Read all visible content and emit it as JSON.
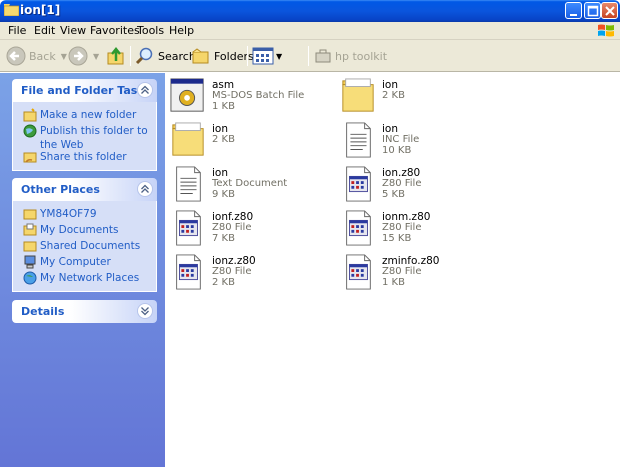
{
  "window": {
    "title": "ion[1]"
  },
  "menu": [
    "File",
    "Edit",
    "View",
    "Favorites",
    "Tools",
    "Help"
  ],
  "toolbar": {
    "back": "Back",
    "search": "Search",
    "folders": "Folders",
    "hp_toolkit": "hp toolkit"
  },
  "tasks": {
    "title": "File and Folder Tasks",
    "items": [
      "Make a new folder",
      "Publish this folder to the Web",
      "Share this folder"
    ]
  },
  "places": {
    "title": "Other Places",
    "items": [
      "YM84OF79",
      "My Documents",
      "Shared Documents",
      "My Computer",
      "My Network Places"
    ]
  },
  "details": {
    "title": "Details"
  },
  "files": [
    {
      "name": "asm",
      "type": "MS-DOS Batch File",
      "size": "1 KB",
      "icon": "batch-file-icon"
    },
    {
      "name": "ion",
      "type": "",
      "size": "2 KB",
      "icon": "folder-icon"
    },
    {
      "name": "ion",
      "type": "",
      "size": "2 KB",
      "icon": "folder-icon"
    },
    {
      "name": "ion",
      "type": "INC File",
      "size": "10 KB",
      "icon": "text-file-icon"
    },
    {
      "name": "ion",
      "type": "Text Document",
      "size": "9 KB",
      "icon": "text-file-icon"
    },
    {
      "name": "ion.z80",
      "type": "Z80 File",
      "size": "5 KB",
      "icon": "z80-file-icon"
    },
    {
      "name": "ionf.z80",
      "type": "Z80 File",
      "size": "7 KB",
      "icon": "z80-file-icon"
    },
    {
      "name": "ionm.z80",
      "type": "Z80 File",
      "size": "15 KB",
      "icon": "z80-file-icon"
    },
    {
      "name": "ionz.z80",
      "type": "Z80 File",
      "size": "2 KB",
      "icon": "z80-file-icon"
    },
    {
      "name": "zminfo.z80",
      "type": "Z80 File",
      "size": "1 KB",
      "icon": "z80-file-icon"
    }
  ]
}
